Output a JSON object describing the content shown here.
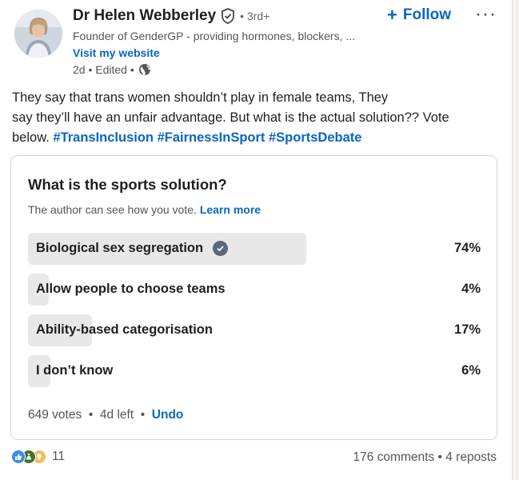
{
  "author": {
    "name": "Dr Helen Webberley",
    "degree": "3rd+",
    "headline": "Founder of GenderGP - providing hormones, blockers, ...",
    "website_label": "Visit my website",
    "time": "2d",
    "edited": "Edited"
  },
  "actions": {
    "follow_label": "Follow",
    "more_label": "···"
  },
  "post": {
    "line1": "They say that trans women shouldn’t play in female teams, They",
    "line2": "say they’ll have an unfair advantage. But what is the actual solution?? Vote",
    "line3_prefix": "below.",
    "hashtags": [
      "#TransInclusion",
      "#FairnessInSport",
      "#SportsDebate"
    ]
  },
  "poll": {
    "question": "What is the sports solution?",
    "note": "The author can see how you vote.",
    "learn_more": "Learn more",
    "options": [
      {
        "label": "Biological sex segregation",
        "percent_label": "74%",
        "percent": 74,
        "selected": true
      },
      {
        "label": "Allow people to choose teams",
        "percent_label": "4%",
        "percent": 4,
        "selected": false
      },
      {
        "label": "Ability-based categorisation",
        "percent_label": "17%",
        "percent": 17,
        "selected": false
      },
      {
        "label": "I don’t know",
        "percent_label": "6%",
        "percent": 6,
        "selected": false
      }
    ],
    "votes": "649 votes",
    "time_left": "4d left",
    "undo_label": "Undo"
  },
  "social": {
    "reaction_count": "11",
    "reactions": [
      "like-icon",
      "celebrate-icon",
      "insightful-icon"
    ],
    "comments": "176 comments",
    "reposts": "4 reposts"
  },
  "colors": {
    "link": "#0a66c2",
    "bar": "#e8e8e8",
    "check": "#56687a"
  }
}
